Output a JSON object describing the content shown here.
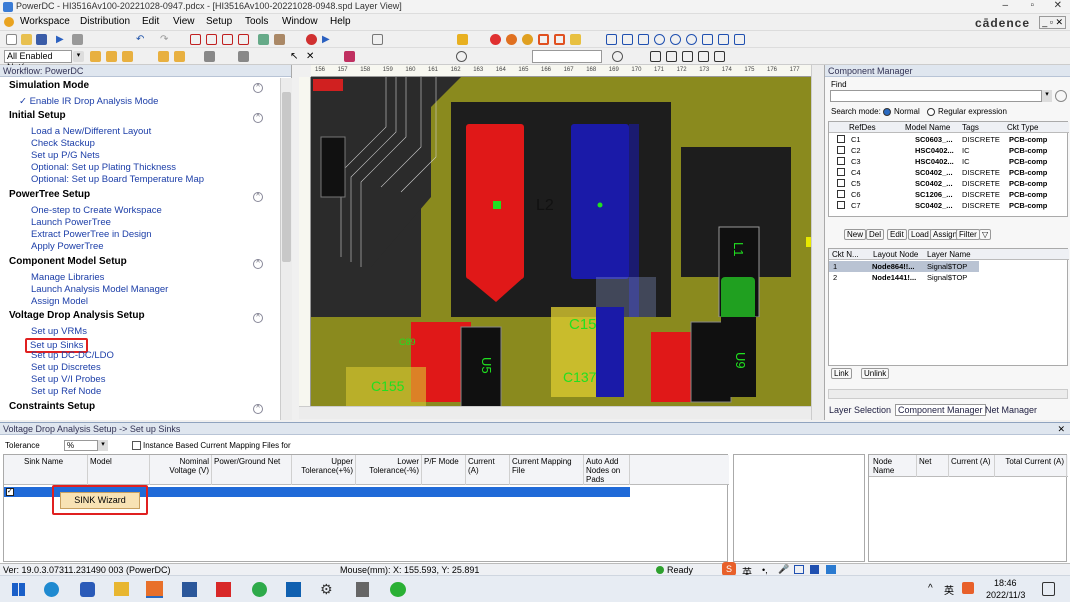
{
  "window": {
    "title": "PowerDC - HI3516Av100-20221028-0947.pdcx - [HI3516Av100-20221028-0948.spd Layer View]",
    "brand": "cādence"
  },
  "menu": [
    "Workspace",
    "Distribution",
    "Edit",
    "View",
    "Setup",
    "Tools",
    "Window",
    "Help"
  ],
  "toolbar": {
    "net_filter": "All Enabled Net("
  },
  "workflow": {
    "header": "Workflow: PowerDC",
    "sections": [
      {
        "title": "Simulation Mode",
        "items": [
          "✓ Enable IR Drop Analysis Mode"
        ]
      },
      {
        "title": "Initial Setup",
        "items": [
          "Load a New/Different Layout",
          "Check Stackup",
          "Set up P/G Nets",
          "Optional: Set up Plating Thickness",
          "Optional: Set up Board Temperature Map"
        ]
      },
      {
        "title": "PowerTree Setup",
        "items": [
          "One-step to Create Workspace",
          "Launch PowerTree",
          "Extract PowerTree in Design",
          "Apply PowerTree"
        ]
      },
      {
        "title": "Component Model Setup",
        "items": [
          "Manage Libraries",
          "Launch Analysis Model Manager",
          "Assign Model"
        ]
      },
      {
        "title": "Voltage Drop Analysis Setup",
        "items": [
          "Set up VRMs",
          "Set up Sinks",
          "Set up DC-DC/LDO",
          "Set up Discretes",
          "Set up V/I Probes",
          "Set up Ref Node"
        ]
      },
      {
        "title": "Constraints Setup",
        "items": []
      }
    ]
  },
  "ruler": [
    "156",
    "157",
    "158",
    "159",
    "160",
    "161",
    "162",
    "163",
    "164",
    "165",
    "166",
    "167",
    "168",
    "169",
    "170",
    "171",
    "172",
    "173",
    "174",
    "175",
    "176",
    "177"
  ],
  "layout_labels": {
    "l2": "L2",
    "l1": "L1",
    "c15": "C15",
    "c137": "C137",
    "c155": "C155",
    "u5": "U5",
    "u9": "U9",
    "c89": "C89"
  },
  "comp_manager": {
    "title": "Component Manager",
    "find_label": "Find",
    "search_mode_label": "Search mode:",
    "mode_normal": "Normal",
    "mode_regex": "Regular expression",
    "columns": [
      "RefDes",
      "Model Name",
      "Tags",
      "Ckt Type"
    ],
    "rows": [
      [
        "C1",
        "SC0603_...",
        "DISCRETE",
        "PCB-comp"
      ],
      [
        "C2",
        "HSC0402...",
        "IC",
        "PCB-comp"
      ],
      [
        "C3",
        "HSC0402...",
        "IC",
        "PCB-comp"
      ],
      [
        "C4",
        "SC0402_...",
        "DISCRETE",
        "PCB-comp"
      ],
      [
        "C5",
        "SC0402_...",
        "DISCRETE",
        "PCB-comp"
      ],
      [
        "C6",
        "SC1206_...",
        "DISCRETE",
        "PCB-comp"
      ],
      [
        "C7",
        "SC0402_...",
        "DISCRETE",
        "PCB-comp"
      ]
    ],
    "buttons": [
      "New",
      "Del",
      "Edit",
      "Load",
      "Assign",
      "Filter"
    ],
    "sub_columns": [
      "Ckt N...",
      "Layout Node",
      "Layer Name"
    ],
    "sub_rows": [
      [
        "1",
        "Node864!!...",
        "Signal$TOP"
      ],
      [
        "2",
        "Node1441!...",
        "Signal$TOP"
      ]
    ],
    "link_buttons": [
      "Link",
      "Unlink"
    ],
    "tabs": [
      "Layer Selection",
      "Component Manager",
      "Net Manager"
    ]
  },
  "vda": {
    "header": "Voltage Drop Analysis Setup -> Set up Sinks",
    "tolerance_label": "Tolerance",
    "tolerance_value": "%",
    "checkbox_label": "Instance Based Current Mapping Files for Sinks",
    "columns": [
      "Sink Name",
      "Model",
      "Nominal Voltage (V)",
      "Power/Ground Net",
      "Upper Tolerance(+%)",
      "Lower Tolerance(-%)",
      "P/F Mode",
      "Current (A)",
      "Current Mapping File",
      "Auto Add Nodes on Pads"
    ],
    "right_columns": [
      "Node Name",
      "Net",
      "Current (A)",
      "Total Current (A)"
    ],
    "wizard_button": "SINK Wizard"
  },
  "status": {
    "version": "Ver: 19.0.3.07311.231490  003 (PowerDC)",
    "mouse": "Mouse(mm): X: 155.593, Y: 25.891",
    "ready": "Ready"
  },
  "taskbar": {
    "ime": "英",
    "time": "18:46",
    "date": "2022/11/3",
    "tray_lang": "英"
  }
}
